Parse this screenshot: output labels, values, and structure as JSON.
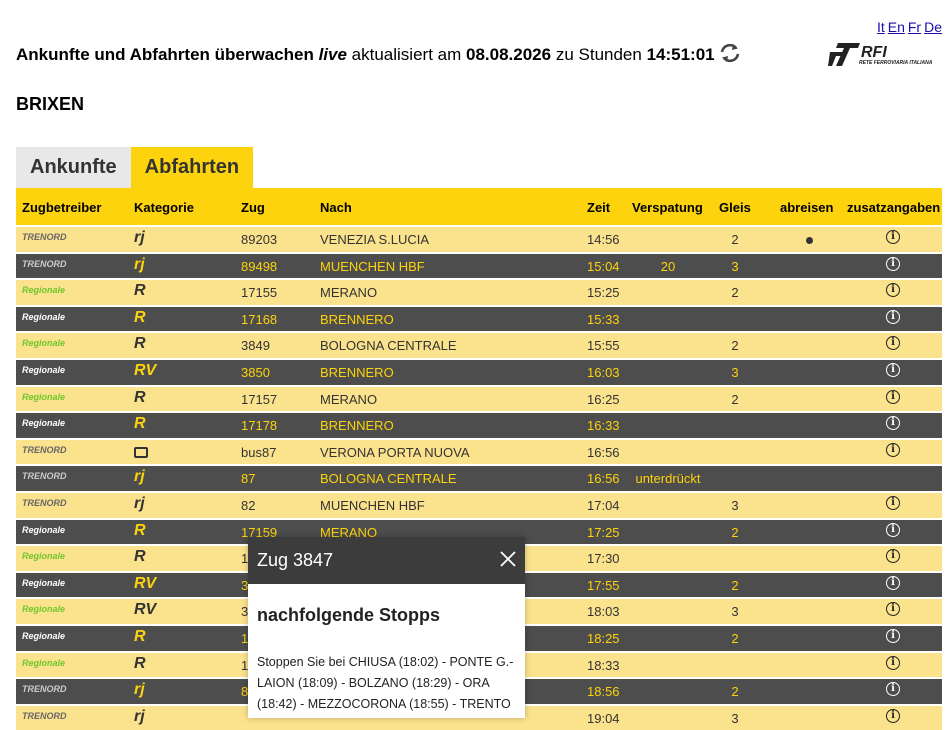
{
  "lang": [
    "It",
    "En",
    "Fr",
    "De"
  ],
  "header": {
    "title_bold": "Ankunfte und Abfahrten überwachen",
    "title_live": "live",
    "updated_label": "aktualisiert am",
    "date": "08.08.2026",
    "time_label": "zu Stunden",
    "time": "14:51:01",
    "logo_text": "RFI",
    "logo_sub": "RETE FERROVIARIA ITALIANA"
  },
  "station": "BRIXEN",
  "tabs": [
    "Ankunfte",
    "Abfahrten"
  ],
  "active_tab": "Abfahrten",
  "columns": [
    "Zugbetreiber",
    "Kategorie",
    "Zug",
    "Nach",
    "Zeit",
    "Verspatung",
    "Gleis",
    "abreisen",
    "zusatzangaben"
  ],
  "rows": [
    {
      "op": "TRENORD",
      "cat": "rj",
      "zug": "89203",
      "nach": "VENEZIA S.LUCIA",
      "zeit": "14:56",
      "versp": "",
      "gleis": "2",
      "dep": true
    },
    {
      "op": "TRENORD",
      "cat": "rj",
      "zug": "89498",
      "nach": "MUENCHEN HBF",
      "zeit": "15:04",
      "versp": "20",
      "gleis": "3",
      "dep": false
    },
    {
      "op": "Regionale",
      "cat": "R",
      "zug": "17155",
      "nach": "MERANO",
      "zeit": "15:25",
      "versp": "",
      "gleis": "2",
      "dep": false
    },
    {
      "op": "Regionale",
      "cat": "R",
      "zug": "17168",
      "nach": "BRENNERO",
      "zeit": "15:33",
      "versp": "",
      "gleis": "",
      "dep": false
    },
    {
      "op": "Regionale",
      "cat": "R",
      "zug": "3849",
      "nach": "BOLOGNA CENTRALE",
      "zeit": "15:55",
      "versp": "",
      "gleis": "2",
      "dep": false
    },
    {
      "op": "Regionale",
      "cat": "RV",
      "zug": "3850",
      "nach": "BRENNERO",
      "zeit": "16:03",
      "versp": "",
      "gleis": "3",
      "dep": false
    },
    {
      "op": "Regionale",
      "cat": "R",
      "zug": "17157",
      "nach": "MERANO",
      "zeit": "16:25",
      "versp": "",
      "gleis": "2",
      "dep": false
    },
    {
      "op": "Regionale",
      "cat": "R",
      "zug": "17178",
      "nach": "BRENNERO",
      "zeit": "16:33",
      "versp": "",
      "gleis": "",
      "dep": false
    },
    {
      "op": "TRENORD",
      "cat": "bus",
      "zug": "bus87",
      "nach": "VERONA PORTA NUOVA",
      "zeit": "16:56",
      "versp": "",
      "gleis": "",
      "dep": false
    },
    {
      "op": "TRENORD",
      "cat": "rj",
      "zug": "87",
      "nach": "BOLOGNA CENTRALE",
      "zeit": "16:56",
      "versp": "unterdrückt",
      "gleis": "",
      "dep": false
    },
    {
      "op": "TRENORD",
      "cat": "rj",
      "zug": "82",
      "nach": "MUENCHEN HBF",
      "zeit": "17:04",
      "versp": "",
      "gleis": "3",
      "dep": false
    },
    {
      "op": "Regionale",
      "cat": "R",
      "zug": "17159",
      "nach": "MERANO",
      "zeit": "17:25",
      "versp": "",
      "gleis": "2",
      "dep": false
    },
    {
      "op": "Regionale",
      "cat": "R",
      "zug": "1",
      "nach": "",
      "zeit": "17:30",
      "versp": "",
      "gleis": "",
      "dep": false
    },
    {
      "op": "Regionale",
      "cat": "RV",
      "zug": "3",
      "nach": "",
      "zeit": "17:55",
      "versp": "",
      "gleis": "2",
      "dep": false
    },
    {
      "op": "Regionale",
      "cat": "RV",
      "zug": "3",
      "nach": "",
      "zeit": "18:03",
      "versp": "",
      "gleis": "3",
      "dep": false
    },
    {
      "op": "Regionale",
      "cat": "R",
      "zug": "1",
      "nach": "",
      "zeit": "18:25",
      "versp": "",
      "gleis": "2",
      "dep": false
    },
    {
      "op": "Regionale",
      "cat": "R",
      "zug": "1",
      "nach": "",
      "zeit": "18:33",
      "versp": "",
      "gleis": "",
      "dep": false
    },
    {
      "op": "TRENORD",
      "cat": "rj",
      "zug": "8",
      "nach": "",
      "zeit": "18:56",
      "versp": "",
      "gleis": "2",
      "dep": false
    },
    {
      "op": "TRENORD",
      "cat": "rj",
      "zug": "",
      "nach": "",
      "zeit": "19:04",
      "versp": "",
      "gleis": "3",
      "dep": false
    }
  ],
  "popup": {
    "title": "Zug 3847",
    "subtitle": "nachfolgende Stopps",
    "text": "Stoppen Sie bei CHIUSA (18:02) - PONTE G.-LAION (18:09) - BOLZANO (18:29) - ORA (18:42) - MEZZOCORONA (18:55) - TRENTO"
  },
  "colors": {
    "accent": "#fcd30c",
    "row_light": "#fbe28d",
    "row_dark": "#4d4d4d"
  }
}
